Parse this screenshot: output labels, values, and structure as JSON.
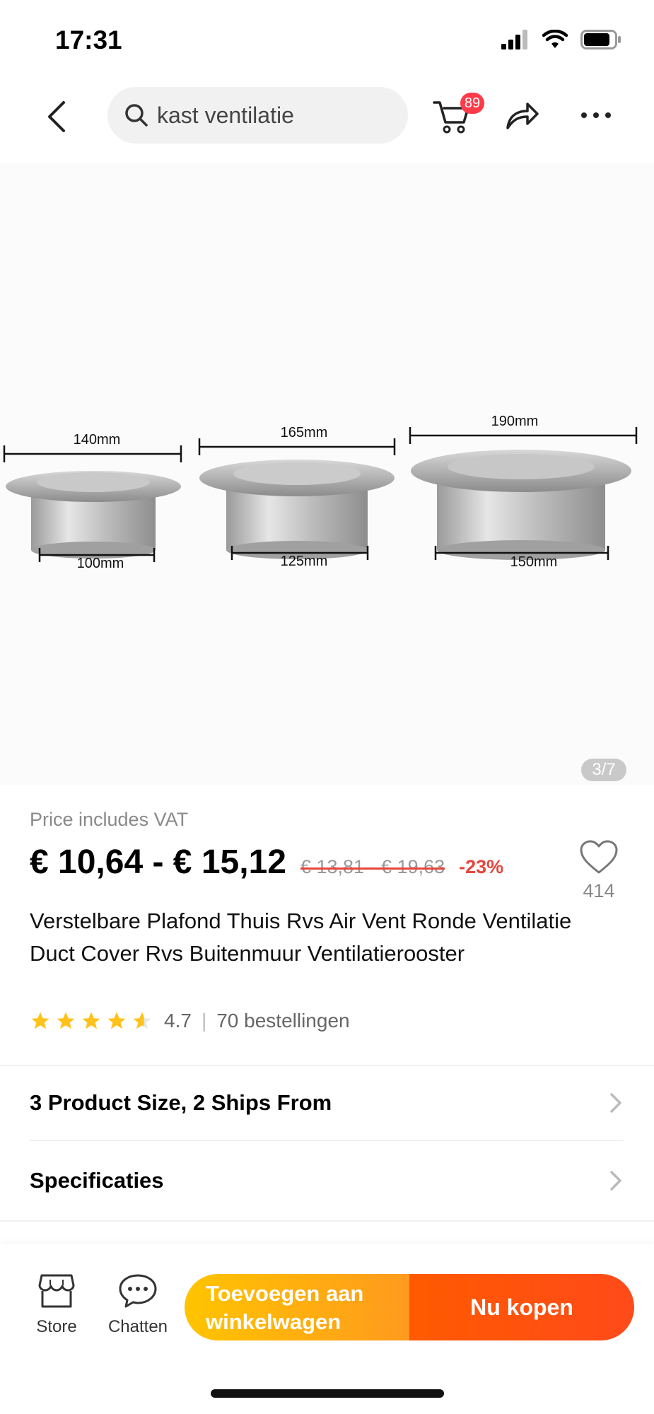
{
  "status_bar": {
    "time": "17:31"
  },
  "search": {
    "query": "kast ventilatie"
  },
  "cart": {
    "badge_count": "89"
  },
  "icons": {
    "back": "chevron-left-icon",
    "search": "search-icon",
    "cart": "cart-icon",
    "share": "share-icon",
    "more": "more-icon",
    "heart": "heart-icon",
    "store": "store-icon",
    "chat": "chat-icon"
  },
  "gallery": {
    "counter": "3/7",
    "dimensions": {
      "top": [
        "140mm",
        "165mm",
        "190mm"
      ],
      "bottom": [
        "100mm",
        "125mm",
        "150mm"
      ]
    }
  },
  "product": {
    "vat_note": "Price includes VAT",
    "price_range": "€ 10,64 - € 15,12",
    "old_price_range": "€ 13,81 - € 19,63",
    "discount": "-23%",
    "wishlist_count": "414",
    "title": "Verstelbare Plafond Thuis Rvs Air Vent Ronde Ventilatie Duct Cover Rvs Buitenmuur Ventilatierooster",
    "rating": "4.7",
    "rating_stars": 4.7,
    "separator": "|",
    "orders": "70 bestellingen"
  },
  "options": {
    "size_ships": "3 Product Size, 2 Ships From",
    "specs": "Specificaties"
  },
  "bottom_bar": {
    "store_label": "Store",
    "chat_label": "Chatten",
    "add_to_cart": "Toevoegen aan winkelwagen",
    "buy_now": "Nu kopen"
  },
  "colors": {
    "accent_red": "#e8453c",
    "cta_orange": "#ff9a1e",
    "cta_red": "#ff4a1a",
    "star_yellow": "#ffc21a"
  }
}
